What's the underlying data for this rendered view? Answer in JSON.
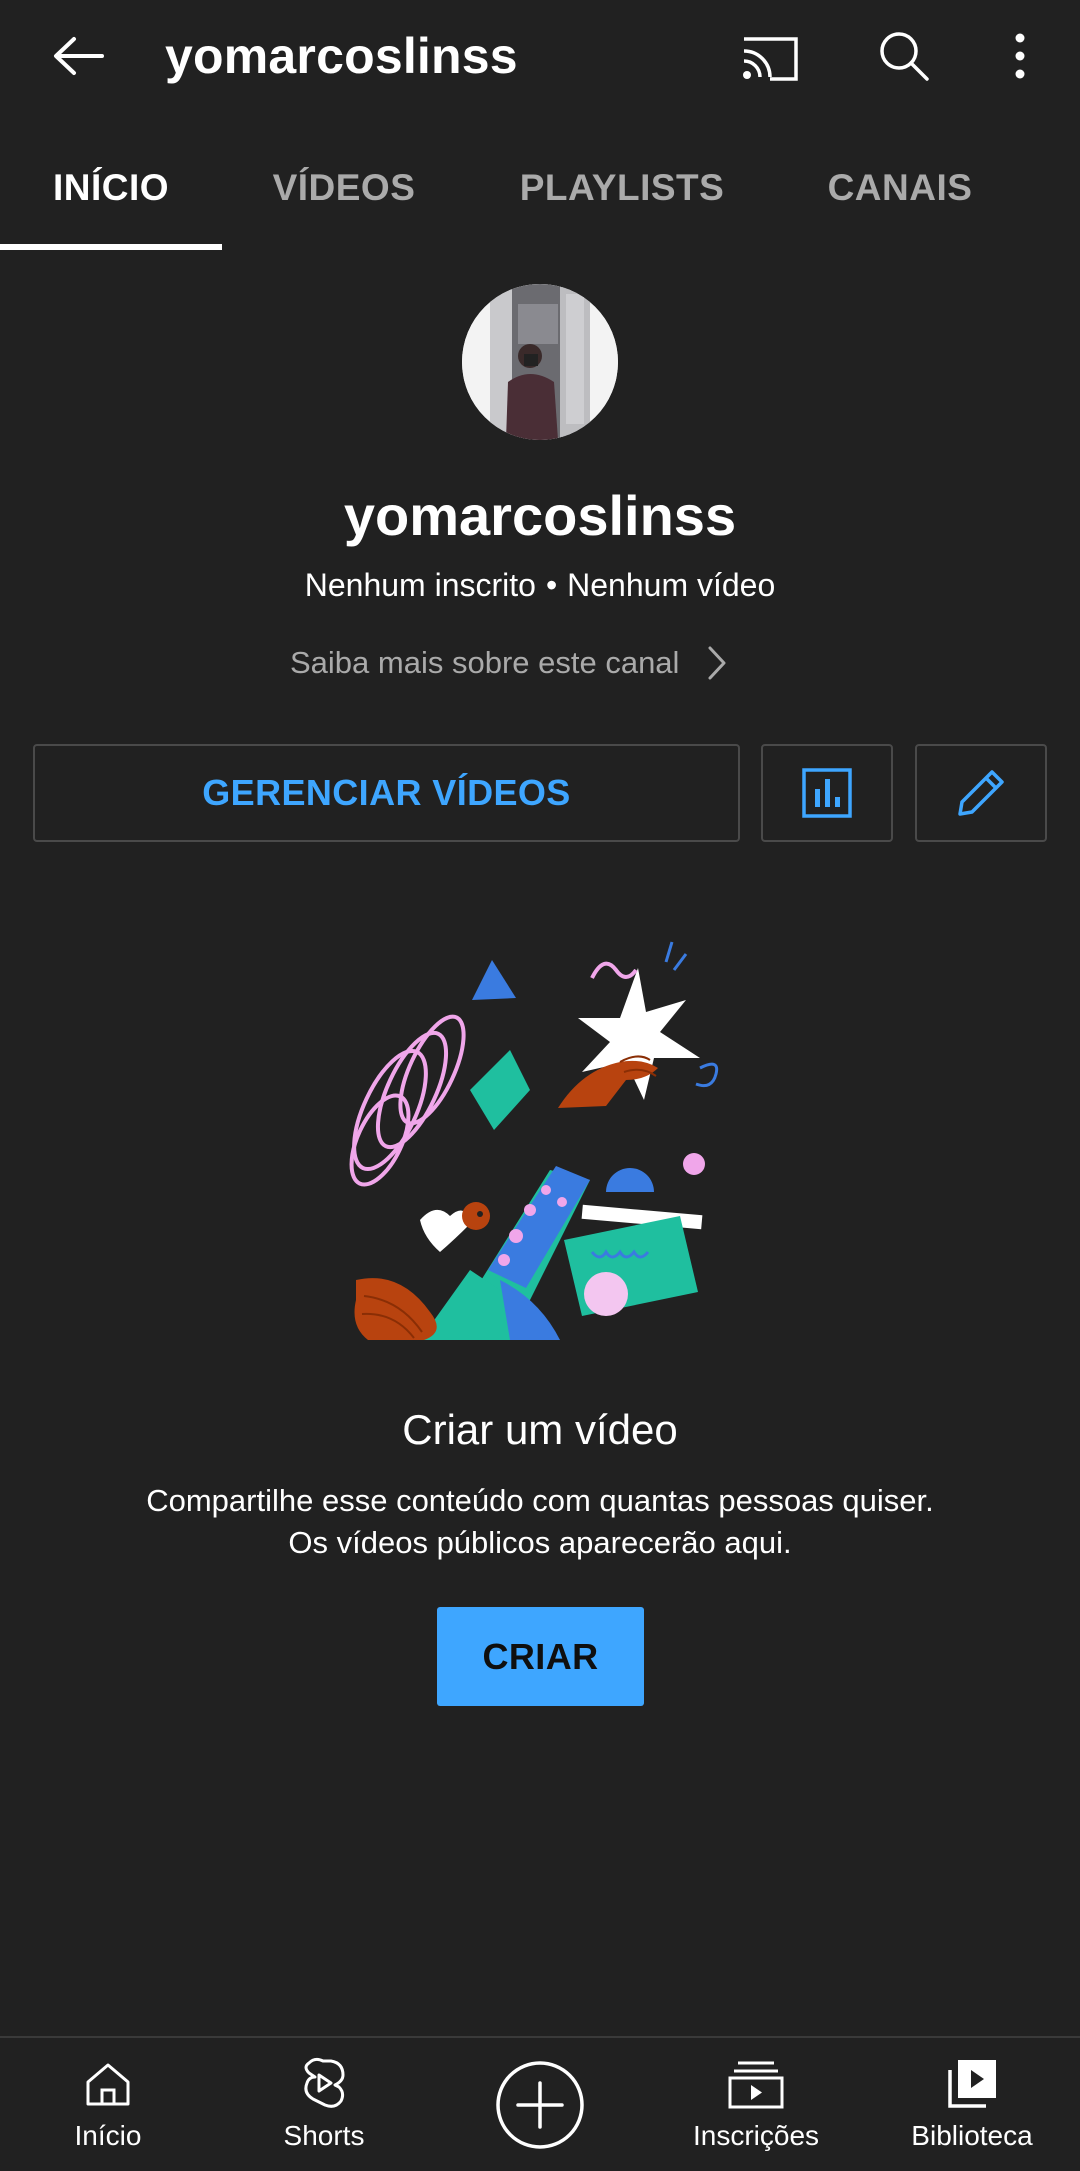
{
  "header": {
    "title": "yomarcoslinss"
  },
  "tabs": [
    {
      "label": "INÍCIO"
    },
    {
      "label": "VÍDEOS"
    },
    {
      "label": "PLAYLISTS"
    },
    {
      "label": "CANAIS"
    }
  ],
  "profile": {
    "name": "yomarcoslinss",
    "subscribers": "Nenhum inscrito",
    "separator": "•",
    "videos": "Nenhum vídeo",
    "about_link": "Saiba mais sobre este canal"
  },
  "actions": {
    "manage_videos": "GERENCIAR VÍDEOS"
  },
  "empty_state": {
    "title": "Criar um vídeo",
    "line1": "Compartilhe esse conteúdo com quantas pessoas quiser.",
    "line2": "Os vídeos públicos aparecerão aqui.",
    "create_button": "CRIAR"
  },
  "bottom_nav": [
    {
      "label": "Início",
      "icon": "home-icon"
    },
    {
      "label": "Shorts",
      "icon": "shorts-icon"
    },
    {
      "label": "",
      "icon": "create-plus-icon"
    },
    {
      "label": "Inscrições",
      "icon": "subscriptions-icon"
    },
    {
      "label": "Biblioteca",
      "icon": "library-icon"
    }
  ],
  "colors": {
    "background": "#212121",
    "accent": "#3ea6ff",
    "secondary_text": "#aaaaaa",
    "border": "#4a4a4a"
  }
}
